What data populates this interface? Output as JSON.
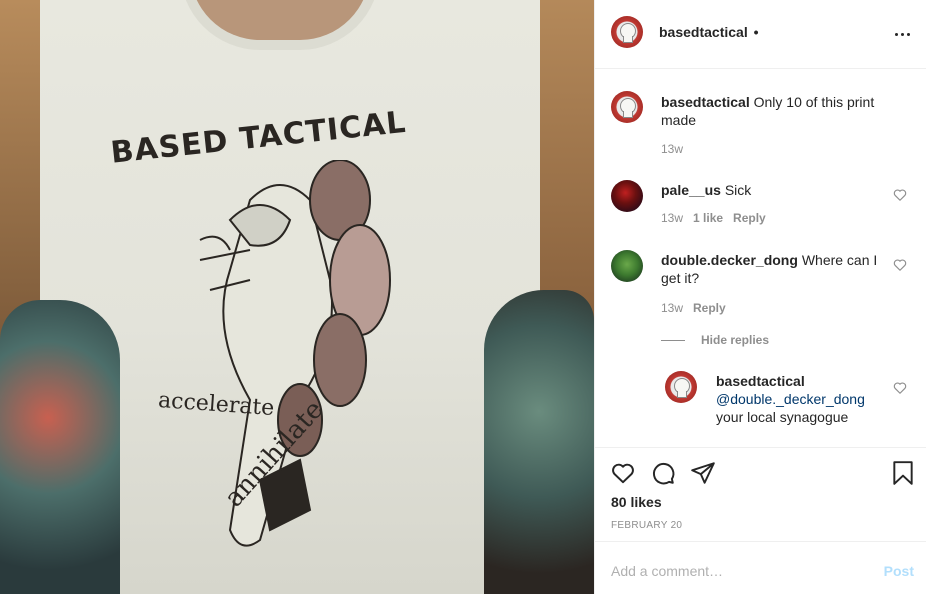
{
  "photo": {
    "print_title": "BASED TACTICAL",
    "print_word_1": "accelerate",
    "print_word_2": "annihilate"
  },
  "header": {
    "username": "basedtactical",
    "separator": "•"
  },
  "caption": {
    "username": "basedtactical",
    "text": "Only 10 of this print made",
    "time": "13w"
  },
  "comments": [
    {
      "username": "pale__us",
      "text": "Sick",
      "time": "13w",
      "likes": "1 like",
      "reply": "Reply"
    },
    {
      "username": "double.decker_dong",
      "text": "Where can I get it?",
      "time": "13w",
      "reply": "Reply"
    }
  ],
  "hide_replies": "Hide replies",
  "reply": {
    "username": "basedtactical",
    "mention": "@double._decker_dong",
    "text": "your local synagogue"
  },
  "actions": {
    "likes": "80 likes",
    "date": "FEBRUARY 20"
  },
  "add_comment": {
    "placeholder": "Add a comment…",
    "post": "Post"
  }
}
